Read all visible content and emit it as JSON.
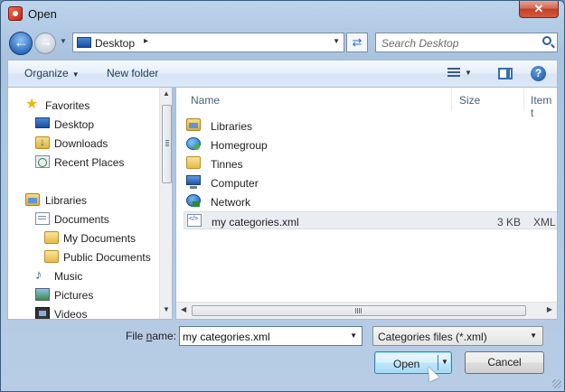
{
  "window": {
    "title": "Open"
  },
  "address_bar": {
    "location": "Desktop",
    "arrow": "▸"
  },
  "search": {
    "placeholder": "Search Desktop"
  },
  "toolbar": {
    "organize": "Organize",
    "new_folder": "New folder",
    "help": "?"
  },
  "navigation": {
    "items": [
      {
        "label": "Favorites",
        "icon": "star-icon"
      },
      {
        "label": "Desktop",
        "icon": "desktop-icon"
      },
      {
        "label": "Downloads",
        "icon": "downloads-folder-icon"
      },
      {
        "label": "Recent Places",
        "icon": "recent-places-icon"
      },
      {
        "label": "Libraries",
        "icon": "libraries-icon"
      },
      {
        "label": "Documents",
        "icon": "documents-icon"
      },
      {
        "label": "My Documents",
        "icon": "folder-icon"
      },
      {
        "label": "Public Documents",
        "icon": "folder-icon"
      },
      {
        "label": "Music",
        "icon": "music-icon"
      },
      {
        "label": "Pictures",
        "icon": "pictures-icon"
      },
      {
        "label": "Videos",
        "icon": "videos-icon"
      }
    ]
  },
  "file_list": {
    "columns": {
      "name": "Name",
      "size": "Size",
      "type": "Item t"
    },
    "rows": [
      {
        "name": "Libraries",
        "size": "",
        "type": "",
        "icon": "libraries-icon"
      },
      {
        "name": "Homegroup",
        "size": "",
        "type": "",
        "icon": "homegroup-icon"
      },
      {
        "name": "Tinnes",
        "size": "",
        "type": "",
        "icon": "user-folder-icon"
      },
      {
        "name": "Computer",
        "size": "",
        "type": "",
        "icon": "computer-icon"
      },
      {
        "name": "Network",
        "size": "",
        "type": "",
        "icon": "network-icon"
      },
      {
        "name": "my categories.xml",
        "size": "3 KB",
        "type": "XML D",
        "icon": "xml-file-icon",
        "selected": true
      }
    ]
  },
  "bottom": {
    "file_name_label_pre": "File ",
    "file_name_label_key": "n",
    "file_name_label_post": "ame:",
    "file_name_value": "my categories.xml",
    "file_type": "Categories files (*.xml)",
    "open_label": "Open",
    "cancel_label": "Cancel"
  }
}
